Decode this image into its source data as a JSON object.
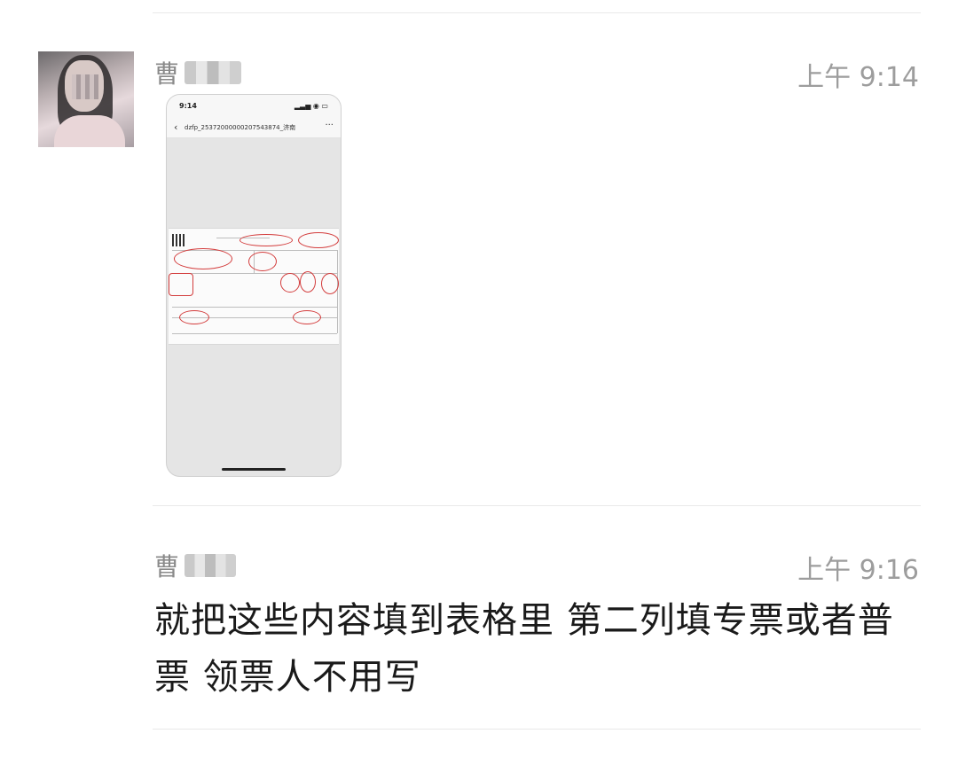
{
  "messages": [
    {
      "sender_visible": "曹",
      "time": "上午 9:14",
      "attachment": {
        "type": "image",
        "phone_clock": "9:14",
        "file_name": "dzfp_25372000000207543874_济南",
        "more": "···"
      }
    },
    {
      "sender_visible": "曹",
      "time": "上午 9:16",
      "text": "就把这些内容填到表格里 第二列填专票或者普票 领票人不用写"
    }
  ],
  "colors": {
    "annotation": "#d33c3c",
    "divider": "#e9e9e9",
    "time_text": "#9d9d9d"
  },
  "icons": [
    "avatar-photo",
    "back-chevron-icon",
    "signal-wifi-battery-icon",
    "more-icon"
  ]
}
